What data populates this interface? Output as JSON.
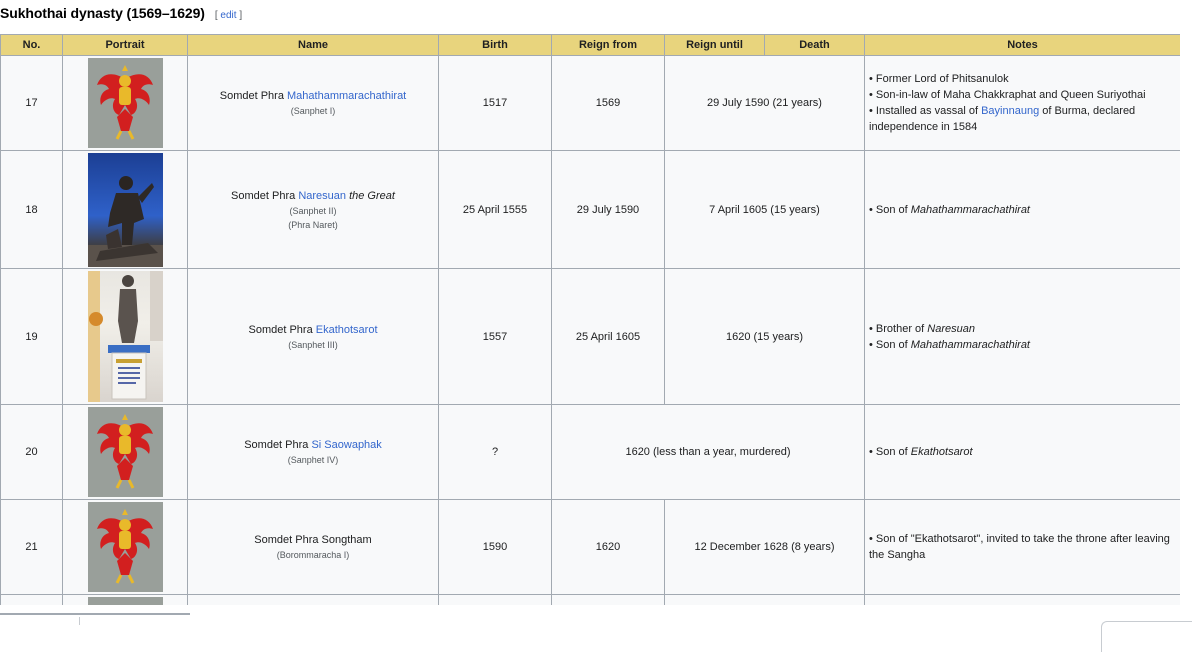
{
  "section": {
    "title": "Sukhothai dynasty (1569–1629)",
    "edit_open": "[ ",
    "edit_label": "edit",
    "edit_close": " ]"
  },
  "columns": [
    "No.",
    "Portrait",
    "Name",
    "Birth",
    "Reign from",
    "Reign until",
    "Death",
    "Notes"
  ],
  "rows": [
    {
      "no": "17",
      "portrait": "garuda-emblem",
      "name_prefix": "Somdet Phra ",
      "name_link": "Mahathammarachathirat",
      "name_suffix": "",
      "alt_names": [
        "(Sanphet I)"
      ],
      "birth": "1517",
      "reign_from": "1569",
      "reign_until_death": "29 July 1590 (21 years)",
      "notes": [
        {
          "pre": "• Former Lord of Phitsanulok"
        },
        {
          "pre": "• Son-in-law of Maha Chakkraphat and Queen Suriyothai"
        },
        {
          "pre": "• Installed as vassal of ",
          "link": "Bayinnaung",
          "post": " of Burma, declared independence in 1584"
        }
      ]
    },
    {
      "no": "18",
      "portrait": "naresuan-statue",
      "name_prefix": "Somdet Phra ",
      "name_link": "Naresuan",
      "name_suffix": " the Great",
      "alt_names": [
        "(Sanphet II)",
        "(Phra Naret)"
      ],
      "birth": "25 April 1555",
      "reign_from": "29 July 1590",
      "reign_until_death": "7 April 1605 (15 years)",
      "notes": [
        {
          "pre": "• Son of ",
          "italic": "Mahathammarachathirat"
        }
      ]
    },
    {
      "no": "19",
      "portrait": "ekathotsarot-statue",
      "name_prefix": "Somdet Phra ",
      "name_link": "Ekathotsarot",
      "name_suffix": "",
      "alt_names": [
        "(Sanphet III)"
      ],
      "birth": "1557",
      "reign_from": "25 April 1605",
      "reign_until_death": "1620 (15 years)",
      "notes": [
        {
          "pre": "• Brother of ",
          "italic": "Naresuan"
        },
        {
          "pre": "• Son of ",
          "italic": "Mahathammarachathirat"
        }
      ]
    },
    {
      "no": "20",
      "portrait": "garuda-emblem",
      "name_prefix": "Somdet Phra ",
      "name_link": "Si Saowaphak",
      "name_suffix": "",
      "alt_names": [
        "(Sanphet IV)"
      ],
      "birth": "?",
      "reign_merged": "1620 (less than a year, murdered)",
      "notes": [
        {
          "pre": "• Son of ",
          "italic": "Ekathotsarot"
        }
      ]
    },
    {
      "no": "21",
      "portrait": "garuda-emblem",
      "name_prefix": "Somdet Phra ",
      "name_link": "Songtham",
      "name_suffix": "",
      "alt_names": [
        "(Borommaracha I)"
      ],
      "birth": "1590",
      "reign_from": "1620",
      "reign_until_death": "12 December 1628 (8 years)",
      "notes": [
        {
          "pre": "• Son of \"Ekathotsarot\", invited to take the throne after leaving the Sangha"
        }
      ]
    }
  ],
  "colors": {
    "header_bg": "#e8d47d",
    "cell_bg": "#f8f9fa",
    "border": "#a2a9b1",
    "link": "#3366cc",
    "garuda_red": "#d21f1f",
    "garuda_gold": "#e9b92a",
    "portrait_gray": "#999f9a"
  }
}
